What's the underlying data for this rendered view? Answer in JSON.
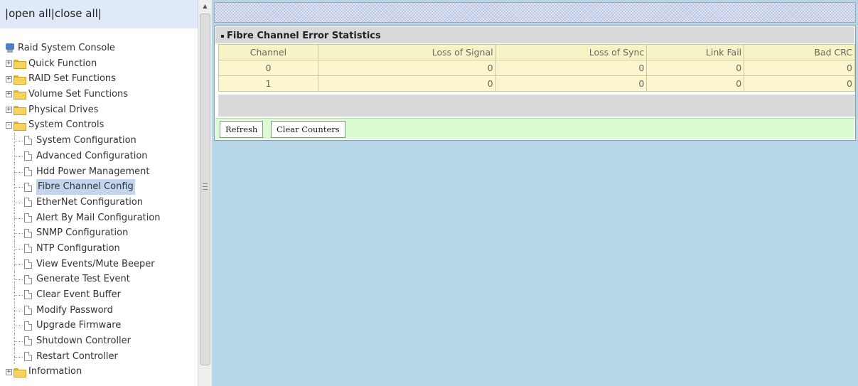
{
  "left_frame": {
    "top_links": {
      "prefix": "|",
      "open_all": "open all",
      "separator": "|",
      "close_all": "close all",
      "suffix": "|"
    },
    "root": {
      "label": "Raid System Console",
      "icon": "console-icon"
    },
    "tree": [
      {
        "label": "Quick Function",
        "expanded": false
      },
      {
        "label": "RAID Set Functions",
        "expanded": false
      },
      {
        "label": "Volume Set Functions",
        "expanded": false
      },
      {
        "label": "Physical Drives",
        "expanded": false
      },
      {
        "label": "System Controls",
        "expanded": true,
        "children": [
          "System Configuration",
          "Advanced Configuration",
          "Hdd Power Management",
          "Fibre Channel Config",
          "EtherNet Configuration",
          "Alert By Mail Configuration",
          "SNMP Configuration",
          "NTP Configuration",
          "View Events/Mute Beeper",
          "Generate Test Event",
          "Clear Event Buffer",
          "Modify Password",
          "Upgrade Firmware",
          "Shutdown Controller",
          "Restart Controller"
        ],
        "selected_child": "Fibre Channel Config"
      },
      {
        "label": "Information",
        "expanded": false
      }
    ],
    "expand_glyph": "+",
    "collapse_glyph": "-"
  },
  "right_frame": {
    "panel_title": "Fibre Channel Error Statistics",
    "table": {
      "headers": [
        "Channel",
        "Loss of Signal",
        "Loss of Sync",
        "Link Fail",
        "Bad CRC"
      ],
      "rows": [
        [
          "0",
          "0",
          "0",
          "0",
          "0"
        ],
        [
          "1",
          "0",
          "0",
          "0",
          "0"
        ]
      ]
    },
    "buttons": {
      "refresh": "Refresh",
      "clear_counters": "Clear Counters"
    }
  },
  "colors": {
    "content_background": "#b6d6e8",
    "table_row": "#fbf6cd",
    "button_bar": "#dbfbd3",
    "selected_item": "#c3d4ee"
  }
}
